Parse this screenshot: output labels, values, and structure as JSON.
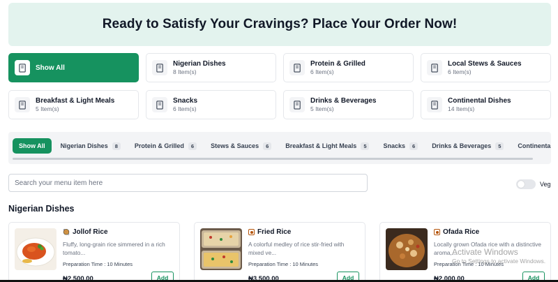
{
  "hero": {
    "title": "Ready to Satisfy Your Cravings? Place Your Order Now!"
  },
  "categories": [
    {
      "name": "Show All",
      "count": "",
      "active": true
    },
    {
      "name": "Nigerian Dishes",
      "count": "8 Item(s)"
    },
    {
      "name": "Protein & Grilled",
      "count": "6 Item(s)"
    },
    {
      "name": "Local Stews & Sauces",
      "count": "6 Item(s)"
    },
    {
      "name": "Breakfast & Light Meals",
      "count": "5 Item(s)"
    },
    {
      "name": "Snacks",
      "count": "6 Item(s)"
    },
    {
      "name": "Drinks & Beverages",
      "count": "5 Item(s)"
    },
    {
      "name": "Continental Dishes",
      "count": "14 Item(s)"
    }
  ],
  "tabs": [
    {
      "label": "Show All",
      "badge": ""
    },
    {
      "label": "Nigerian Dishes",
      "badge": "8"
    },
    {
      "label": "Protein & Grilled",
      "badge": "6"
    },
    {
      "label": "Stews & Sauces",
      "badge": "6"
    },
    {
      "label": "Breakfast & Light Meals",
      "badge": "5"
    },
    {
      "label": "Snacks",
      "badge": "6"
    },
    {
      "label": "Drinks & Beverages",
      "badge": "5"
    },
    {
      "label": "Continental",
      "badge": ""
    }
  ],
  "search": {
    "placeholder": "Search your menu item here"
  },
  "veg_toggle": {
    "label": "Veg"
  },
  "section": {
    "title": "Nigerian Dishes"
  },
  "items": [
    {
      "name": "Jollof Rice",
      "description": "Fluffy, long-grain rice simmered in a rich tomato...",
      "prep": "Preparation Time : 10 Minutes",
      "price": "₦2,500.00",
      "add_label": "Add"
    },
    {
      "name": "Fried Rice",
      "description": "A colorful medley of rice stir-fried with mixed ve...",
      "prep": "Preparation Time : 10 Minutes",
      "price": "₦3,500.00",
      "add_label": "Add"
    },
    {
      "name": "Ofada Rice",
      "description": "Locally grown Ofada rice with a distinctive aroma,...",
      "prep": "Preparation Time : 10 Minutes",
      "price": "₦2,000.00",
      "add_label": "Add"
    }
  ],
  "watermark": {
    "line1": "Activate Windows",
    "line2": "Go to Settings to activate Windows."
  },
  "colors": {
    "accent": "#16925f",
    "hero_bg": "#e3f3ee"
  }
}
